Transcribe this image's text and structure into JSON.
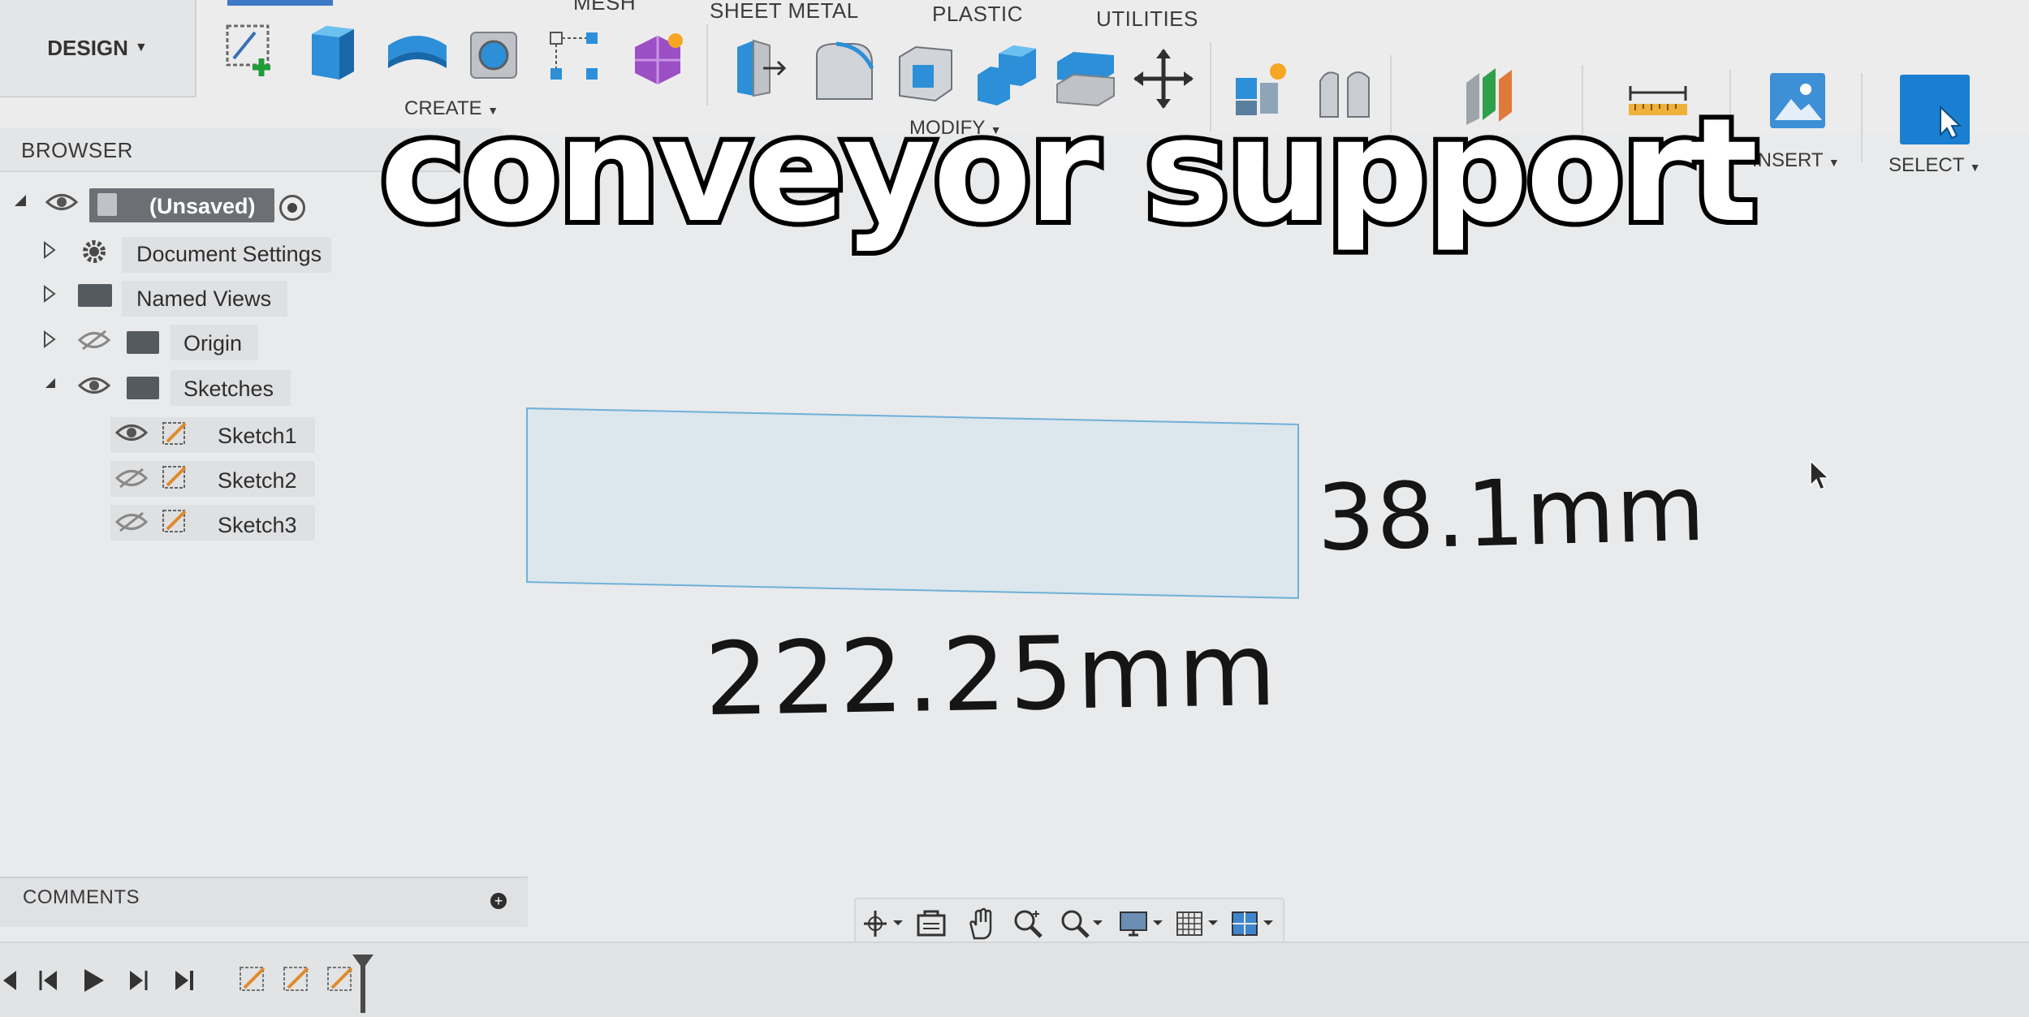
{
  "toolbar": {
    "workspace_label": "DESIGN",
    "tabs": [
      "MESH",
      "SHEET METAL",
      "PLASTIC",
      "UTILITIES"
    ],
    "groups": {
      "create": "CREATE",
      "modify": "MODIFY",
      "insert": "INSERT",
      "select": "SELECT"
    },
    "accent": "#3e79c5"
  },
  "browser": {
    "title": "BROWSER",
    "root": "(Unsaved)",
    "items": [
      {
        "label": "Document Settings",
        "icon": "gear-icon"
      },
      {
        "label": "Named Views",
        "icon": "folder-icon"
      },
      {
        "label": "Origin",
        "icon": "folder-icon",
        "visible": false
      },
      {
        "label": "Sketches",
        "icon": "folder-icon",
        "visible": true
      },
      {
        "label": "Sketch1",
        "icon": "sketch-icon",
        "visible": true
      },
      {
        "label": "Sketch2",
        "icon": "sketch-icon",
        "visible": false
      },
      {
        "label": "Sketch3",
        "icon": "sketch-icon",
        "visible": false
      }
    ]
  },
  "canvas": {
    "overlay_title": "conveyor support",
    "dim_height": "38.1mm",
    "dim_width": "222.25mm",
    "sketch_fill": "#dbe6ed",
    "sketch_stroke": "#6fb0d8"
  },
  "comments": {
    "title": "COMMENTS"
  },
  "navbar": {
    "icons": [
      "orbit-icon",
      "look-at-icon",
      "pan-icon",
      "zoom-icon",
      "fit-icon",
      "display-settings-icon",
      "grid-icon",
      "viewports-icon"
    ]
  },
  "timeline": {
    "controls": [
      "first-icon",
      "prev-icon",
      "play-icon",
      "next-icon",
      "last-icon"
    ],
    "features": [
      "sketch-icon",
      "sketch-icon",
      "sketch-icon"
    ]
  }
}
